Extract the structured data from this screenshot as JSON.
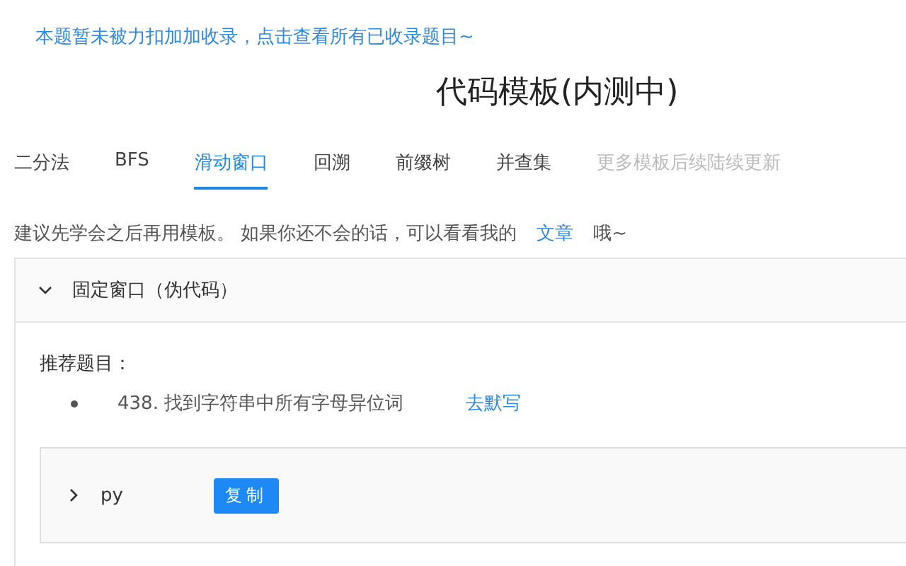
{
  "notice": "本题暂未被力扣加加收录，点击查看所有已收录题目~",
  "title": "代码模板(内测中)",
  "tabs": [
    {
      "label": "二分法",
      "selected": false,
      "disabled": false
    },
    {
      "label": "BFS",
      "selected": false,
      "disabled": false
    },
    {
      "label": "滑动窗口",
      "selected": true,
      "disabled": false
    },
    {
      "label": "回溯",
      "selected": false,
      "disabled": false
    },
    {
      "label": "前缀树",
      "selected": false,
      "disabled": false
    },
    {
      "label": "并查集",
      "selected": false,
      "disabled": false
    },
    {
      "label": "更多模板后续陆续更新",
      "selected": false,
      "disabled": true
    }
  ],
  "hint": {
    "text": "建议先学会之后再用模板。 如果你还不会的话，可以看看我的",
    "link": "文章",
    "suffix": "哦~"
  },
  "panel": {
    "title": "固定窗口（伪代码）",
    "expanded": true,
    "recommend_label": "推荐题目：",
    "problems": [
      {
        "title": "438. 找到字符串中所有字母异位词",
        "action": "去默写"
      }
    ],
    "code": {
      "language": "py",
      "expanded": false,
      "copy_button": "复制"
    }
  }
}
